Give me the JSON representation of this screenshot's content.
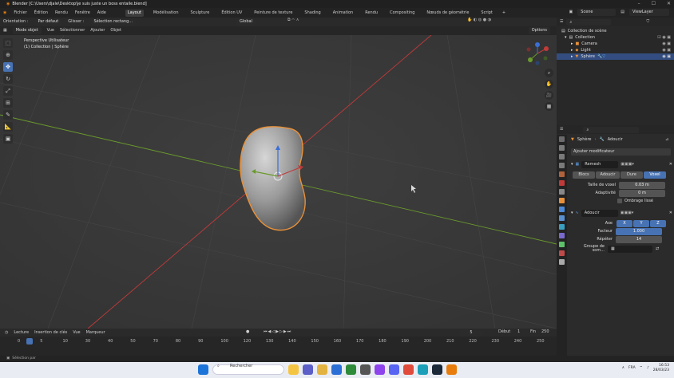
{
  "window": {
    "title": "Blender [C:\\Users\\djale\\Desktop\\je suis juste un boss entaile.blend]"
  },
  "menu": {
    "items": [
      "Fichier",
      "Édition",
      "Rendu",
      "Fenêtre",
      "Aide"
    ],
    "workspaces": [
      "Layout",
      "Modélisation",
      "Sculpture",
      "Édition UV",
      "Peinture de texture",
      "Shading",
      "Animation",
      "Rendu",
      "Compositing",
      "Nœuds de géométrie",
      "Script"
    ],
    "add_tab": "+",
    "scene": "Scene",
    "view_layer": "ViewLayer"
  },
  "header": {
    "mode": "Mode objet",
    "menus": [
      "Vue",
      "Sélectionner",
      "Ajouter",
      "Objet"
    ],
    "orientation_label": "Orientation :",
    "orientation_value": "Par défaut",
    "drag_label": "Glisser :",
    "drag_value": "Sélection rectang...",
    "transform": "Global",
    "options": "Options"
  },
  "viewport": {
    "line1": "Perspective Utilisateur",
    "line2": "(1) Collection | Sphère"
  },
  "outliner": {
    "search_placeholder": "",
    "rows": [
      {
        "label": "Collection de scène"
      },
      {
        "label": "Collection"
      },
      {
        "label": "Camera"
      },
      {
        "label": "Light"
      },
      {
        "label": "Sphère"
      }
    ]
  },
  "properties": {
    "breadcrumb_object": "Sphère",
    "breadcrumb_modifier": "Adoucir",
    "add_modifier": "Ajouter modificateur",
    "remesh": {
      "name": "Remesh",
      "modes": [
        "Blocs",
        "Adoucir",
        "Dure",
        "Voxel"
      ],
      "active_mode": "Voxel",
      "voxel_size_label": "Taille de voxel",
      "voxel_size_value": "0.03 m",
      "adaptivity_label": "Adaptivité",
      "adaptivity_value": "0 m",
      "smooth_shading_label": "Ombrage lissé"
    },
    "smooth": {
      "name": "Adoucir",
      "axis_label": "Axe",
      "axes": [
        "X",
        "Y",
        "Z"
      ],
      "factor_label": "Facteur",
      "factor_value": "1.000",
      "repeat_label": "Répéter",
      "repeat_value": "14",
      "vertex_group_label": "Groupe de som..."
    }
  },
  "timeline": {
    "menus": [
      "Lecture",
      "Insertion de clés",
      "Vue",
      "Marqueur"
    ],
    "current_frame": "5",
    "start_label": "Début",
    "start_value": "1",
    "end_label": "Fin",
    "end_value": "250",
    "ruler": [
      "0",
      "5",
      "10",
      "30",
      "40",
      "50",
      "70",
      "80",
      "90",
      "100",
      "120",
      "130",
      "140",
      "150",
      "160",
      "170",
      "180",
      "190",
      "200",
      "210",
      "220",
      "230",
      "240",
      "250"
    ]
  },
  "statusbar": {
    "text": "Sélection par"
  },
  "taskbar": {
    "search": "Rechercher",
    "lang": "FRA",
    "time": "16:53",
    "date": "28/03/23"
  },
  "colors": {
    "accent": "#4772b3",
    "selected_outline": "#e8913a",
    "x_axis": "#c23a3a",
    "y_axis": "#6a9a2c"
  }
}
